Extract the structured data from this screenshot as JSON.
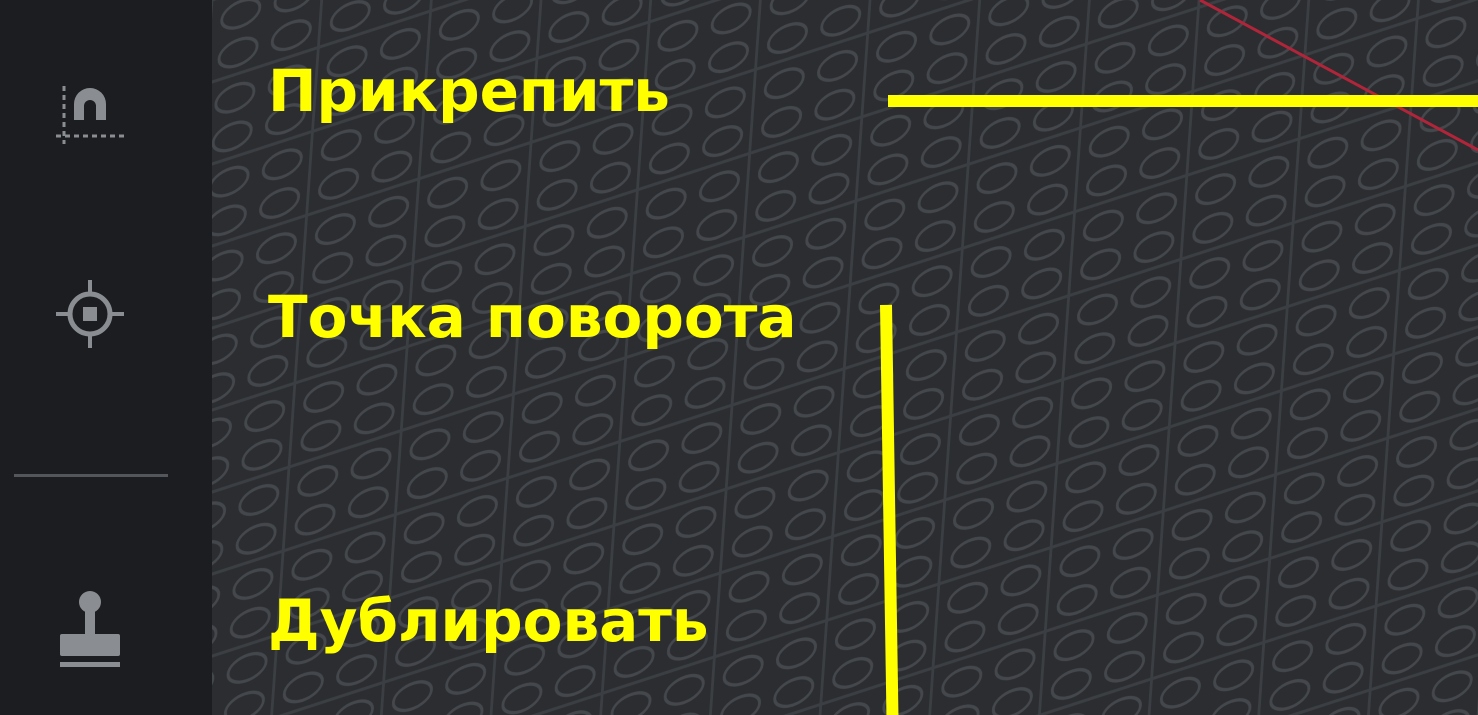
{
  "toolbar": {
    "tools": [
      {
        "id": "snap",
        "icon": "magnet-snap-icon"
      },
      {
        "id": "pivot",
        "icon": "pivot-target-icon"
      },
      {
        "id": "clone",
        "icon": "stamp-icon"
      }
    ]
  },
  "annotations": {
    "snap_label": "Прикрепить",
    "pivot_label": "Точка поворота",
    "clone_label": "Дублировать"
  },
  "colors": {
    "annotation": "#ffff00",
    "toolbar_bg": "#1b1d20",
    "viewport_bg": "#2b2d30",
    "icon": "#8a8d92",
    "axis_line": "#b0253a"
  }
}
